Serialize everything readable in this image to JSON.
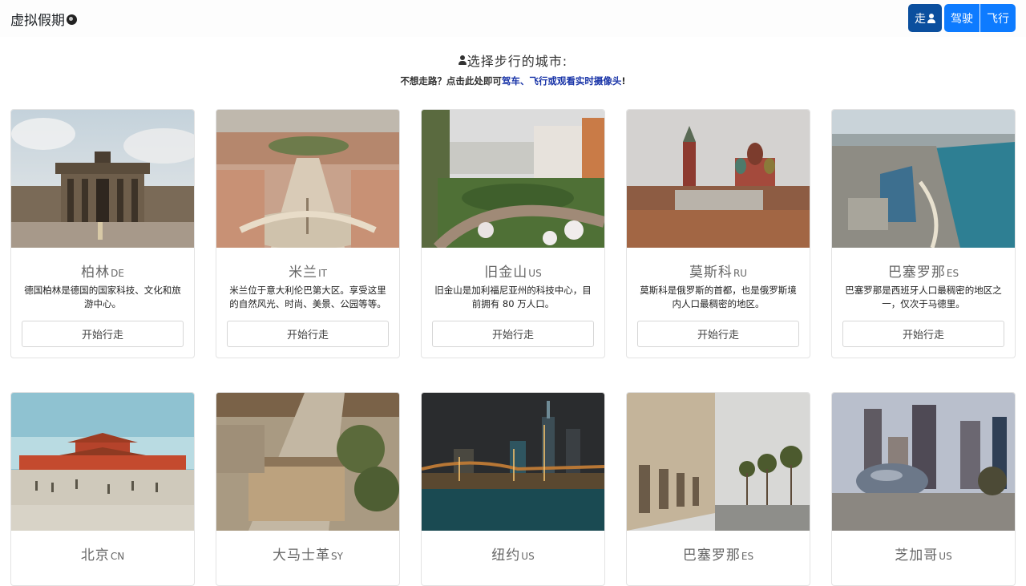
{
  "navbar": {
    "brand": "虚拟假期",
    "modes": [
      {
        "label": "走",
        "active": true
      },
      {
        "label": "驾驶",
        "active": false
      },
      {
        "label": "飞行",
        "active": false
      }
    ]
  },
  "heading": "选择步行的城市:",
  "sub": {
    "prefix": "不想走路？点击此处即可",
    "drive": "驾车",
    "sep": "、",
    "fly": "飞行",
    "or": "或",
    "webcams": "观看实时摄像头",
    "suffix": "!"
  },
  "colors": {
    "accent": "#0d7bff",
    "accent_active": "#0b4f9e",
    "link": "#1a35a8"
  },
  "cities": [
    {
      "name": "柏林",
      "code": "DE",
      "desc": "德国柏林是德国的国家科技、文化和旅游中心。",
      "button": "开始行走"
    },
    {
      "name": "米兰",
      "code": "IT",
      "desc": "米兰位于意大利伦巴第大区。享受这里的自然风光、时尚、美景、公园等等。",
      "button": "开始行走"
    },
    {
      "name": "旧金山",
      "code": "US",
      "desc": "旧金山是加利福尼亚州的科技中心，目前拥有 80 万人口。",
      "button": "开始行走"
    },
    {
      "name": "莫斯科",
      "code": "RU",
      "desc": "莫斯科是俄罗斯的首都，也是俄罗斯境内人口最稠密的地区。",
      "button": "开始行走"
    },
    {
      "name": "巴塞罗那",
      "code": "ES",
      "desc": "巴塞罗那是西班牙人口最稠密的地区之一，仅次于马德里。",
      "button": "开始行走"
    },
    {
      "name": "北京",
      "code": "CN",
      "desc": "",
      "button": ""
    },
    {
      "name": "大马士革",
      "code": "SY",
      "desc": "",
      "button": ""
    },
    {
      "name": "纽约",
      "code": "US",
      "desc": "",
      "button": ""
    },
    {
      "name": "巴塞罗那",
      "code": "ES",
      "desc": "",
      "button": ""
    },
    {
      "name": "芝加哥",
      "code": "US",
      "desc": "",
      "button": ""
    }
  ]
}
